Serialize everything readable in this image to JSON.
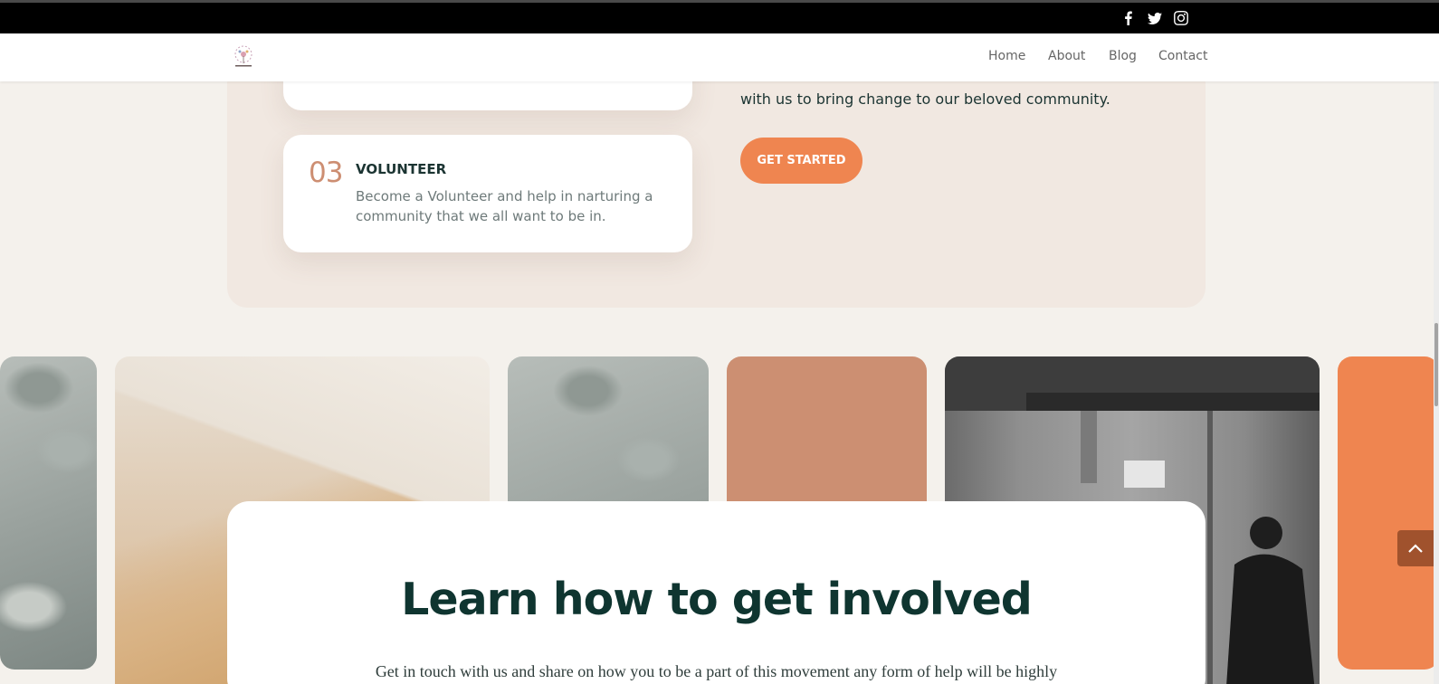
{
  "social": [
    {
      "name": "facebook-icon",
      "glyph": "f"
    },
    {
      "name": "twitter-icon",
      "glyph": "twitter"
    },
    {
      "name": "instagram-icon",
      "glyph": "instagram"
    }
  ],
  "nav": {
    "items": [
      {
        "label": "Home"
      },
      {
        "label": "About"
      },
      {
        "label": "Blog"
      },
      {
        "label": "Contact"
      }
    ]
  },
  "volunteer_card": {
    "number": "03",
    "title": "VOLUNTEER",
    "text": "Become a Volunteer and help in narturing a community that we all want to be in."
  },
  "intro": {
    "text": "with us to bring change to our beloved community.",
    "cta_label": "GET STARTED"
  },
  "involved": {
    "heading": "Learn how to get involved",
    "body": "Get in touch with us and share on how you to be a part of this movement any form of help will be highly"
  },
  "colors": {
    "accent_orange": "#ef8550",
    "terracotta": "#cc8f72",
    "dark_teal": "#0f3530",
    "section_bg": "#f1e8e1",
    "back_to_top": "#a0522d"
  }
}
